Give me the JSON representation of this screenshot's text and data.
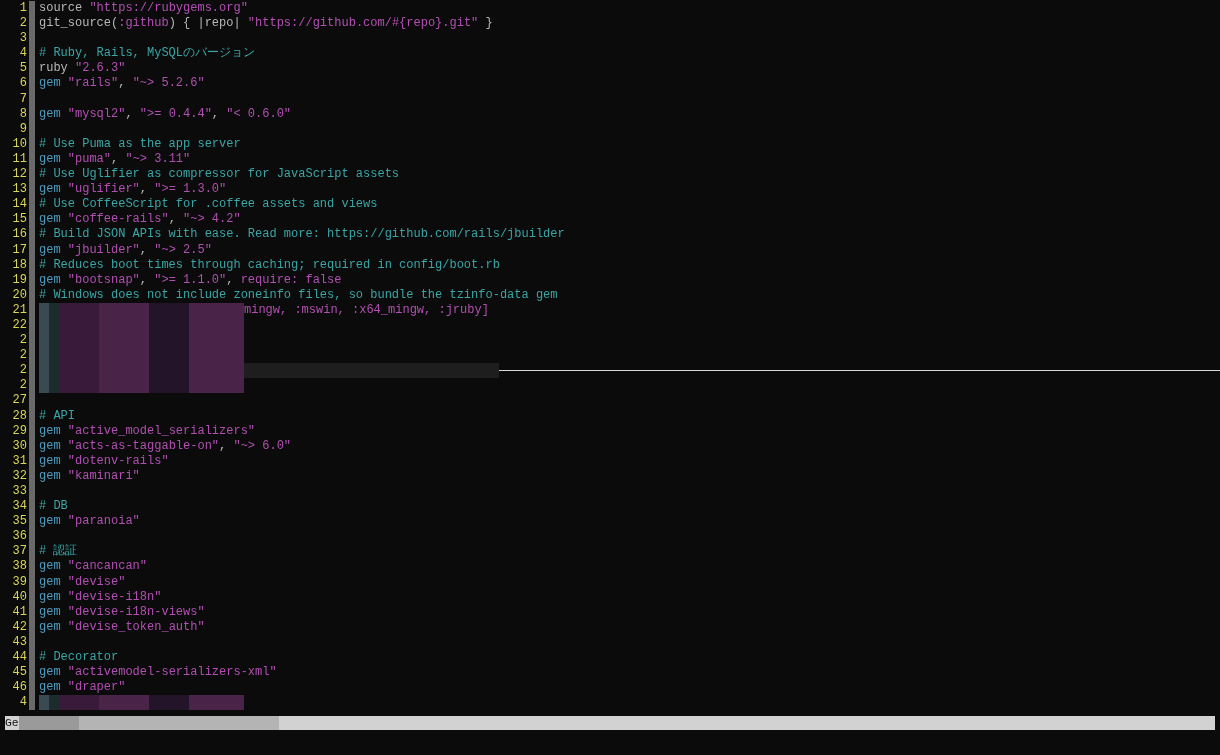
{
  "editor": {
    "lines": [
      {
        "number": "1",
        "tokens": [
          {
            "kind": "plain",
            "text": "source "
          },
          {
            "kind": "string",
            "text": "\"https://rubygems.org\""
          }
        ]
      },
      {
        "number": "2",
        "tokens": [
          {
            "kind": "plain",
            "text": "git_source("
          },
          {
            "kind": "string",
            "text": ":github"
          },
          {
            "kind": "plain",
            "text": ") { |repo| "
          },
          {
            "kind": "string",
            "text": "\"https://github.com/#{repo}.git\""
          },
          {
            "kind": "plain",
            "text": " }"
          }
        ]
      },
      {
        "number": "3"
      },
      {
        "number": "4",
        "tokens": [
          {
            "kind": "comment",
            "text": "# Ruby, Rails, MySQLのバージョン"
          }
        ]
      },
      {
        "number": "5",
        "tokens": [
          {
            "kind": "plain",
            "text": "ruby "
          },
          {
            "kind": "string",
            "text": "\"2.6.3\""
          }
        ]
      },
      {
        "number": "6",
        "tokens": [
          {
            "kind": "keyword",
            "text": "gem "
          },
          {
            "kind": "string",
            "text": "\"rails\""
          },
          {
            "kind": "plain",
            "text": ", "
          },
          {
            "kind": "string",
            "text": "\"~> 5.2.6\""
          }
        ]
      },
      {
        "number": "7"
      },
      {
        "number": "8",
        "tokens": [
          {
            "kind": "keyword",
            "text": "gem "
          },
          {
            "kind": "string",
            "text": "\"mysql2\""
          },
          {
            "kind": "plain",
            "text": ", "
          },
          {
            "kind": "string",
            "text": "\">= 0.4.4\""
          },
          {
            "kind": "plain",
            "text": ", "
          },
          {
            "kind": "string",
            "text": "\"< 0.6.0\""
          }
        ]
      },
      {
        "number": "9"
      },
      {
        "number": "10",
        "tokens": [
          {
            "kind": "comment",
            "text": "# Use Puma as the app server"
          }
        ]
      },
      {
        "number": "11",
        "tokens": [
          {
            "kind": "keyword",
            "text": "gem "
          },
          {
            "kind": "string",
            "text": "\"puma\""
          },
          {
            "kind": "plain",
            "text": ", "
          },
          {
            "kind": "string",
            "text": "\"~> 3.11\""
          }
        ]
      },
      {
        "number": "12",
        "tokens": [
          {
            "kind": "comment",
            "text": "# Use Uglifier as compressor for JavaScript assets"
          }
        ]
      },
      {
        "number": "13",
        "tokens": [
          {
            "kind": "keyword",
            "text": "gem "
          },
          {
            "kind": "string",
            "text": "\"uglifier\""
          },
          {
            "kind": "plain",
            "text": ", "
          },
          {
            "kind": "string",
            "text": "\">= 1.3.0\""
          }
        ]
      },
      {
        "number": "14",
        "tokens": [
          {
            "kind": "comment",
            "text": "# Use CoffeeScript for .coffee assets and views"
          }
        ]
      },
      {
        "number": "15",
        "tokens": [
          {
            "kind": "keyword",
            "text": "gem "
          },
          {
            "kind": "string",
            "text": "\"coffee-rails\""
          },
          {
            "kind": "plain",
            "text": ", "
          },
          {
            "kind": "string",
            "text": "\"~> 4.2\""
          }
        ]
      },
      {
        "number": "16",
        "tokens": [
          {
            "kind": "comment",
            "text": "# Build JSON APIs with ease. Read more: https://github.com/rails/jbuilder"
          }
        ]
      },
      {
        "number": "17",
        "tokens": [
          {
            "kind": "keyword",
            "text": "gem "
          },
          {
            "kind": "string",
            "text": "\"jbuilder\""
          },
          {
            "kind": "plain",
            "text": ", "
          },
          {
            "kind": "string",
            "text": "\"~> 2.5\""
          }
        ]
      },
      {
        "number": "18",
        "tokens": [
          {
            "kind": "comment",
            "text": "# Reduces boot times through caching; required in config/boot.rb"
          }
        ]
      },
      {
        "number": "19",
        "tokens": [
          {
            "kind": "keyword",
            "text": "gem "
          },
          {
            "kind": "string",
            "text": "\"bootsnap\""
          },
          {
            "kind": "plain",
            "text": ", "
          },
          {
            "kind": "string",
            "text": "\">= 1.1.0\""
          },
          {
            "kind": "plain",
            "text": ", "
          },
          {
            "kind": "string",
            "text": "require: false"
          }
        ]
      },
      {
        "number": "20",
        "tokens": [
          {
            "kind": "comment",
            "text": "# Windows does not include zoneinfo files, so bundle the tzinfo-data gem"
          }
        ]
      },
      {
        "number": "21",
        "obscured": true,
        "tokens": [
          {
            "kind": "string",
            "text": "mingw, :mswin, :x64_mingw, :jruby]"
          }
        ]
      },
      {
        "number": "22",
        "obscured": true
      },
      {
        "number": "2",
        "obscured": true
      },
      {
        "number": "2",
        "obscured": true
      },
      {
        "number": "2",
        "obscured": true,
        "cursor": true
      },
      {
        "number": "2",
        "obscured": true
      },
      {
        "number": "27"
      },
      {
        "number": "28",
        "tokens": [
          {
            "kind": "comment",
            "text": "# API"
          }
        ]
      },
      {
        "number": "29",
        "tokens": [
          {
            "kind": "keyword",
            "text": "gem "
          },
          {
            "kind": "string",
            "text": "\"active_model_serializers\""
          }
        ]
      },
      {
        "number": "30",
        "tokens": [
          {
            "kind": "keyword",
            "text": "gem "
          },
          {
            "kind": "string",
            "text": "\"acts-as-taggable-on\""
          },
          {
            "kind": "plain",
            "text": ", "
          },
          {
            "kind": "string",
            "text": "\"~> 6.0\""
          }
        ]
      },
      {
        "number": "31",
        "tokens": [
          {
            "kind": "keyword",
            "text": "gem "
          },
          {
            "kind": "string",
            "text": "\"dotenv-rails\""
          }
        ]
      },
      {
        "number": "32",
        "tokens": [
          {
            "kind": "keyword",
            "text": "gem "
          },
          {
            "kind": "string",
            "text": "\"kaminari\""
          }
        ]
      },
      {
        "number": "33"
      },
      {
        "number": "34",
        "tokens": [
          {
            "kind": "comment",
            "text": "# DB"
          }
        ]
      },
      {
        "number": "35",
        "tokens": [
          {
            "kind": "keyword",
            "text": "gem "
          },
          {
            "kind": "string",
            "text": "\"paranoia\""
          }
        ]
      },
      {
        "number": "36"
      },
      {
        "number": "37",
        "tokens": [
          {
            "kind": "comment",
            "text": "# 認証"
          }
        ]
      },
      {
        "number": "38",
        "tokens": [
          {
            "kind": "keyword",
            "text": "gem "
          },
          {
            "kind": "string",
            "text": "\"cancancan\""
          }
        ]
      },
      {
        "number": "39",
        "tokens": [
          {
            "kind": "keyword",
            "text": "gem "
          },
          {
            "kind": "string",
            "text": "\"devise\""
          }
        ]
      },
      {
        "number": "40",
        "tokens": [
          {
            "kind": "keyword",
            "text": "gem "
          },
          {
            "kind": "string",
            "text": "\"devise-i18n\""
          }
        ]
      },
      {
        "number": "41",
        "tokens": [
          {
            "kind": "keyword",
            "text": "gem "
          },
          {
            "kind": "string",
            "text": "\"devise-i18n-views\""
          }
        ]
      },
      {
        "number": "42",
        "tokens": [
          {
            "kind": "keyword",
            "text": "gem "
          },
          {
            "kind": "string",
            "text": "\"devise_token_auth\""
          }
        ]
      },
      {
        "number": "43"
      },
      {
        "number": "44",
        "tokens": [
          {
            "kind": "comment",
            "text": "# Decorator"
          }
        ]
      },
      {
        "number": "45",
        "tokens": [
          {
            "kind": "keyword",
            "text": "gem "
          },
          {
            "kind": "string",
            "text": "\"activemodel-serializers-xml\""
          }
        ]
      },
      {
        "number": "46",
        "tokens": [
          {
            "kind": "keyword",
            "text": "gem "
          },
          {
            "kind": "string",
            "text": "\"draper\""
          }
        ]
      },
      {
        "number": "4",
        "obscured": true
      }
    ]
  },
  "status_bar": {
    "text": "Ge"
  }
}
